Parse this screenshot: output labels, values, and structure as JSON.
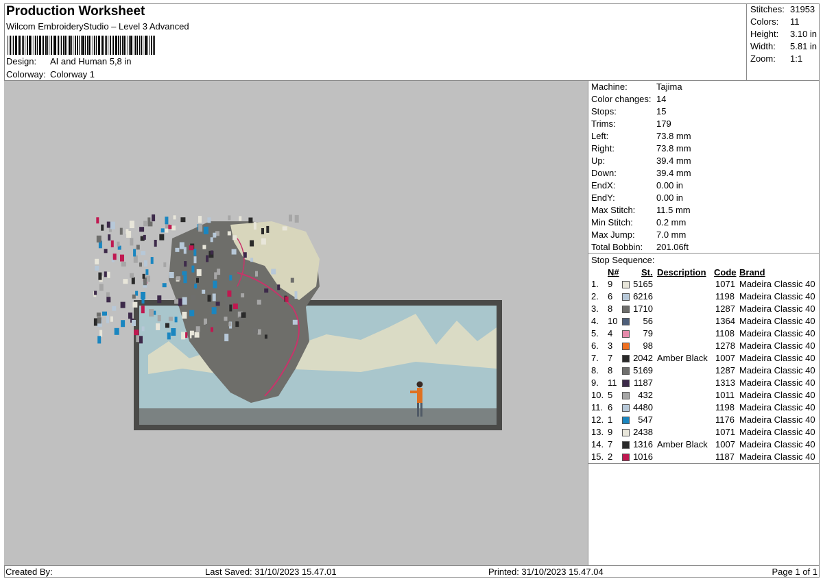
{
  "header": {
    "title": "Production Worksheet",
    "software": "Wilcom EmbroideryStudio – Level 3 Advanced",
    "design_label": "Design:",
    "design_value": "AI and Human 5,8 in",
    "colorway_label": "Colorway:",
    "colorway_value": "Colorway 1"
  },
  "stats": [
    {
      "label": "Stitches:",
      "value": "31953"
    },
    {
      "label": "Colors:",
      "value": "11"
    },
    {
      "label": "Height:",
      "value": "3.10 in"
    },
    {
      "label": "Width:",
      "value": "5.81 in"
    },
    {
      "label": "Zoom:",
      "value": "1:1"
    }
  ],
  "machine_info": [
    {
      "label": "Machine:",
      "value": "Tajima"
    },
    {
      "label": "Color changes:",
      "value": "14"
    },
    {
      "label": "Stops:",
      "value": "15"
    },
    {
      "label": "Trims:",
      "value": "179"
    },
    {
      "label": "Left:",
      "value": "73.8 mm"
    },
    {
      "label": "Right:",
      "value": "73.8 mm"
    },
    {
      "label": "Up:",
      "value": "39.4 mm"
    },
    {
      "label": "Down:",
      "value": "39.4 mm"
    },
    {
      "label": "EndX:",
      "value": "0.00 in"
    },
    {
      "label": "EndY:",
      "value": "0.00 in"
    },
    {
      "label": "Max Stitch:",
      "value": "11.5 mm"
    },
    {
      "label": "Min Stitch:",
      "value": "0.2 mm"
    },
    {
      "label": "Max Jump:",
      "value": "7.0 mm"
    },
    {
      "label": "Total Bobbin:",
      "value": "201.06ft"
    }
  ],
  "stop_sequence": {
    "title": "Stop Sequence:",
    "headers": {
      "n": "N#",
      "st": "St.",
      "desc": "Description",
      "code": "Code",
      "brand": "Brand"
    },
    "rows": [
      {
        "idx": "1.",
        "n": "9",
        "color": "#e8e6da",
        "st": "5165",
        "desc": "",
        "code": "1071",
        "brand": "Madeira Classic 40"
      },
      {
        "idx": "2.",
        "n": "6",
        "color": "#b7c8d8",
        "st": "6216",
        "desc": "",
        "code": "1198",
        "brand": "Madeira Classic 40"
      },
      {
        "idx": "3.",
        "n": "8",
        "color": "#6e6e6c",
        "st": "1710",
        "desc": "",
        "code": "1287",
        "brand": "Madeira Classic 40"
      },
      {
        "idx": "4.",
        "n": "10",
        "color": "#4e5f7a",
        "st": "56",
        "desc": "",
        "code": "1364",
        "brand": "Madeira Classic 40"
      },
      {
        "idx": "5.",
        "n": "4",
        "color": "#e58aaa",
        "st": "79",
        "desc": "",
        "code": "1108",
        "brand": "Madeira Classic 40"
      },
      {
        "idx": "6.",
        "n": "3",
        "color": "#f07020",
        "st": "98",
        "desc": "",
        "code": "1278",
        "brand": "Madeira Classic 40"
      },
      {
        "idx": "7.",
        "n": "7",
        "color": "#2a2a2a",
        "st": "2042",
        "desc": "Amber Black",
        "code": "1007",
        "brand": "Madeira Classic 40"
      },
      {
        "idx": "8.",
        "n": "8",
        "color": "#6e6e6c",
        "st": "5169",
        "desc": "",
        "code": "1287",
        "brand": "Madeira Classic 40"
      },
      {
        "idx": "9.",
        "n": "11",
        "color": "#3d2a4a",
        "st": "1187",
        "desc": "",
        "code": "1313",
        "brand": "Madeira Classic 40"
      },
      {
        "idx": "10.",
        "n": "5",
        "color": "#a6a6a6",
        "st": "432",
        "desc": "",
        "code": "1011",
        "brand": "Madeira Classic 40"
      },
      {
        "idx": "11.",
        "n": "6",
        "color": "#b7c8d8",
        "st": "4480",
        "desc": "",
        "code": "1198",
        "brand": "Madeira Classic 40"
      },
      {
        "idx": "12.",
        "n": "1",
        "color": "#1a86c0",
        "st": "547",
        "desc": "",
        "code": "1176",
        "brand": "Madeira Classic 40"
      },
      {
        "idx": "13.",
        "n": "9",
        "color": "#e8e6da",
        "st": "2438",
        "desc": "",
        "code": "1071",
        "brand": "Madeira Classic 40"
      },
      {
        "idx": "14.",
        "n": "7",
        "color": "#2a2a2a",
        "st": "1316",
        "desc": "Amber Black",
        "code": "1007",
        "brand": "Madeira Classic 40"
      },
      {
        "idx": "15.",
        "n": "2",
        "color": "#c01850",
        "st": "1016",
        "desc": "",
        "code": "1187",
        "brand": "Madeira Classic 40"
      }
    ]
  },
  "footer": {
    "created_by": "Created By:",
    "last_saved": "Last Saved: 31/10/2023 15.47.01",
    "printed": "Printed: 31/10/2023 15.47.04",
    "page": "Page 1 of 1"
  }
}
